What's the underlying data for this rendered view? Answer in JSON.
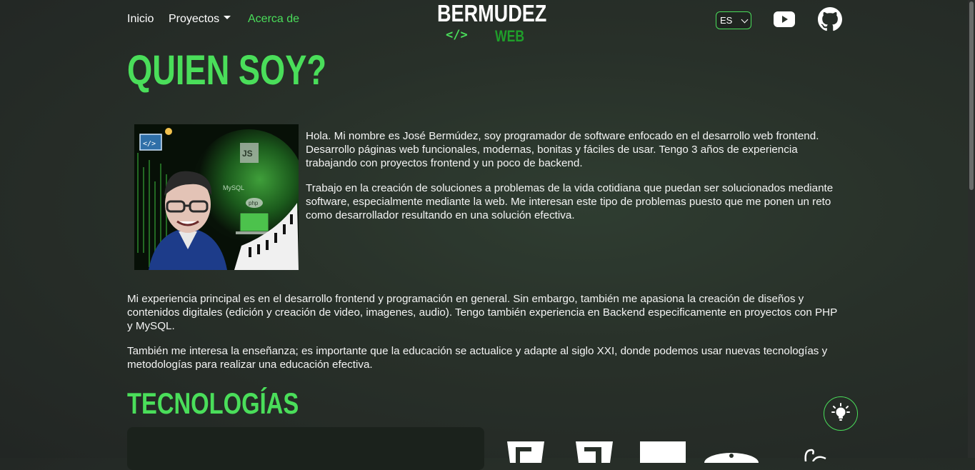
{
  "nav": {
    "links": [
      {
        "label": "Inicio"
      },
      {
        "label": "Proyectos"
      },
      {
        "label": "Acerca de"
      }
    ],
    "language": "ES"
  },
  "logo": {
    "top": "BERMUDEZ",
    "code": "</>",
    "web": "WEB"
  },
  "about": {
    "title": "QUIEN SOY?",
    "intro": "Hola. Mi nombre es José Bermúdez, soy programador de software enfocado en el desarrollo web frontend. Desarrollo páginas web funcionales, modernas, bonitas y fáciles de usar. Tengo 3 años de experiencia trabajando con proyectos frontend y un poco de backend.",
    "work": "Trabajo en la creación de soluciones a problemas de la vida cotidiana que puedan ser solucionados mediante software, especialmente mediante la web. Me interesan este tipo de problemas puesto que me ponen un reto como desarrollador resultando en una solución efectiva.",
    "experience": "Mi experiencia principal es en el desarrollo frontend y programación en general. Sin embargo, también me apasiona la creación de diseños y contenidos digitales (edición y creación de video, imagenes, audio). Tengo también experiencia en Backend especificamente en proyectos con PHP y MySQL.",
    "teaching": "También me interesa la enseñanza; es importante que la educación se actualice y adapte al siglo XXI, donde podemos usar nuevas tecnologías y metodologías para realizar una educación efectiva."
  },
  "tech": {
    "title": "TECNOLOGÍAS",
    "icons": [
      "html5-icon",
      "css3-icon",
      "javascript-icon",
      "mysql-icon",
      "sass-icon"
    ]
  },
  "photo": {
    "badges": [
      "JS",
      "MySQL",
      "php"
    ]
  },
  "colors": {
    "accent": "#4ade5a",
    "logo_web": "#1f9e2a",
    "background": "#283029"
  }
}
